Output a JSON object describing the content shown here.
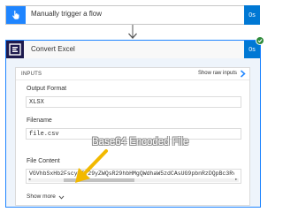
{
  "trigger": {
    "title": "Manually trigger a flow",
    "duration": "0s"
  },
  "action": {
    "title": "Convert Excel",
    "duration": "0s",
    "status": "succeeded",
    "inputs": {
      "header_label": "INPUTS",
      "show_raw_label": "Show raw inputs",
      "fields": {
        "output_format": {
          "label": "Output Format",
          "value": "XLSX"
        },
        "filename": {
          "label": "Filename",
          "value": "file.csv"
        },
        "file_content": {
          "label": "File Content",
          "value": "VGVhbSxHb2FscyBTY29yZWQsR29hbHMgQWdhaW5zdCAsUG9pbnRzDQpBc3Rvbi"
        }
      },
      "show_more_label": "Show more"
    }
  },
  "annotation": {
    "text": "Base64 Encoded File"
  },
  "colors": {
    "accent": "#0078d4",
    "card_border": "#1f85ff",
    "trigger_icon": "#1f85ff",
    "action_logo": "#1d1a4e",
    "success": "#2e8b3a",
    "annotation_arrow": "#f2b900"
  },
  "icons": {
    "trigger": "hand-pointer-icon",
    "action": "encodian-logo-icon",
    "connector": "arrow-down-icon",
    "status": "check-circle-icon",
    "raw_inputs": "chevron-right-icon",
    "show_more": "chevron-down-icon"
  }
}
